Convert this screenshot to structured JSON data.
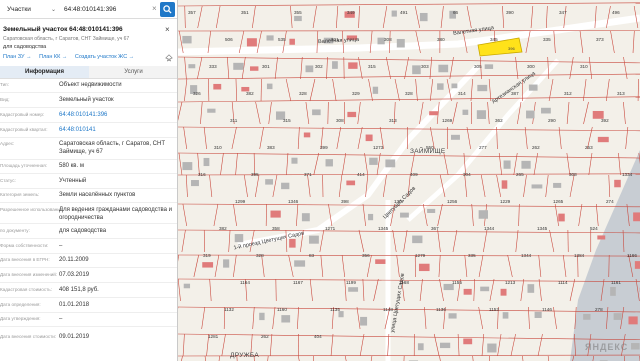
{
  "search": {
    "type_label": "Участки",
    "query": "64:48:010141:396"
  },
  "parcel": {
    "title": "Земельный участок 64:48:010141:396",
    "address_short": "Саратовская область, г Саратов, СНТ Займище, уч 67",
    "use": "для садоводства",
    "links": [
      "План ЗУ →",
      "План КК →",
      "Создать участок ЖС →"
    ]
  },
  "tabs": [
    {
      "label": "Информация",
      "active": true
    },
    {
      "label": "Услуги",
      "active": false
    }
  ],
  "info": [
    {
      "label": "Тип:",
      "value": "Объект недвижимости"
    },
    {
      "label": "Вид:",
      "value": "Земельный участок"
    },
    {
      "label": "Кадастровый номер:",
      "value": "64:48:010141:396",
      "link": true
    },
    {
      "label": "Кадастровый квартал:",
      "value": "64:48:010141",
      "link": true
    },
    {
      "label": "Адрес:",
      "value": "Саратовская область, г Саратов, СНТ Займище, уч 67"
    },
    {
      "label": "Площадь уточненная:",
      "value": "580 кв. м"
    },
    {
      "label": "Статус:",
      "value": "Учтенный"
    },
    {
      "label": "Категория земель:",
      "value": "Земли населённых пунктов"
    },
    {
      "label": "Разрешенное использование:",
      "value": "Для ведения гражданами садоводства и огородничества"
    },
    {
      "label": "по документу:",
      "value": "для садоводства"
    },
    {
      "label": "Форма собственности:",
      "value": "–"
    },
    {
      "label": "Дата внесения в ЕГРН:",
      "value": "20.11.2009"
    },
    {
      "label": "Дата внесения изменений:",
      "value": "07.03.2019"
    },
    {
      "label": "Кадастровая стоимость:",
      "value": "408 151,8 руб."
    },
    {
      "label": "Дата определения:",
      "value": "01.01.2018"
    },
    {
      "label": "Дата утверждения:",
      "value": "–"
    },
    {
      "label": "Дата внесения стоимости:",
      "value": "09.01.2019"
    }
  ],
  "map": {
    "streets": [
      "Валетная улица",
      "Валетная улица",
      "Артезианская улица",
      "Цветущих Садов",
      "1-й проезд Цветущих Садов",
      "улица Цветущих Садов"
    ],
    "district": "ЗАЙМИЩЕ",
    "district2": "ДРУЖБА",
    "watermark": "ЯНДЕКС",
    "parcel_numbers": [
      "357",
      "351",
      "355",
      "349",
      "491",
      "66",
      "390",
      "347",
      "496",
      "506",
      "535",
      "321",
      "308",
      "380",
      "345",
      "335",
      "373",
      "333",
      "301",
      "302",
      "315",
      "303",
      "305",
      "300",
      "310",
      "326",
      "382",
      "328",
      "329",
      "328",
      "314",
      "387",
      "312",
      "313",
      "311",
      "315",
      "308",
      "313",
      "1269",
      "362",
      "290",
      "392",
      "310",
      "383",
      "399",
      "1273",
      "550",
      "277",
      "262",
      "253",
      "316",
      "395",
      "371",
      "414",
      "409",
      "304",
      "265",
      "308",
      "1334",
      "1299",
      "1346",
      "398",
      "1307",
      "1256",
      "1229",
      "1265",
      "274",
      "382",
      "358",
      "1271",
      "1345",
      "367",
      "1344",
      "1345",
      "524",
      "319",
      "328",
      "83",
      "356",
      "1279",
      "335",
      "1344",
      "1384",
      "1166",
      "1164",
      "1167",
      "1199",
      "1168",
      "1155",
      "1213",
      "1114",
      "1161",
      "1132",
      "1160",
      "1135",
      "1148",
      "1136",
      "1153",
      "1146",
      "278",
      "1281",
      "262",
      "404"
    ],
    "colors": {
      "background": "#f3f0e9",
      "parcel_line": "#c9493e",
      "selected": "#ffe21a",
      "building": "#b5b5b5",
      "water": "#c8cdd3",
      "accent": "#1f78c8"
    }
  }
}
